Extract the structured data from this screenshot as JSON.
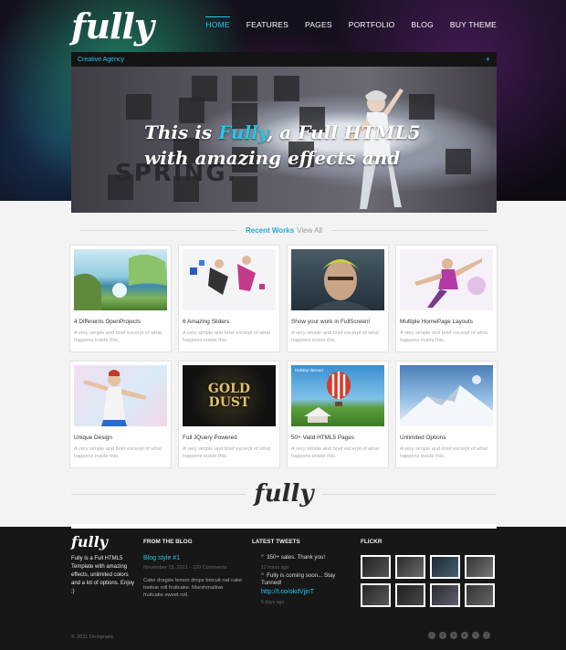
{
  "header": {
    "logo": "fully",
    "nav": [
      "HOME",
      "FEATURES",
      "PAGES",
      "PORTFOLIO",
      "BLOG",
      "BUY THEME"
    ]
  },
  "slider": {
    "caption": "Creative Agency",
    "plus": "+",
    "headline_part1": "This is ",
    "headline_accent": "Fully",
    "headline_part2": ", a Full HTML5",
    "headline_line2": "with amazing effects and",
    "overlay_word": "SPRING."
  },
  "recent_works": {
    "title": "Recent Works",
    "view_all": "View All",
    "items": [
      {
        "title": "4 Differents OpenProjects",
        "desc": "A very simple and brief excerpt of what happens inside this."
      },
      {
        "title": "6 Amazing Sliders",
        "desc": "A very simple and brief excerpt of what happens inside this."
      },
      {
        "title": "Show your work in FullScreen!",
        "desc": "A very simple and brief excerpt of what happens inside this."
      },
      {
        "title": "Multiple HomePage Layouts",
        "desc": "A very simple and brief excerpt of what happens inside this."
      },
      {
        "title": "Unique Design",
        "desc": "A very simple and brief excerpt of what happens inside this."
      },
      {
        "title": "Full JQuery Powered",
        "desc": "A very simple and brief excerpt of what happens inside this."
      },
      {
        "title": "50+ Valid HTML5 Pages",
        "desc": "A very simple and brief excerpt of what happens inside this."
      },
      {
        "title": "Unlimited Options",
        "desc": "A very simple and brief excerpt of what happens inside this."
      }
    ],
    "thumb_texts": {
      "gold_dust": "GOLD DUST",
      "holiday": "Holiday dessert"
    }
  },
  "divider_logo": "fully",
  "footer": {
    "logo": "fully",
    "about": "Fully is a Full HTML5 Template with amazing effects, unlimited colors and a lot of options. Enjoy ;)",
    "blog": {
      "title": "FROM THE BLOG",
      "post_title": "Blog style #1",
      "post_meta": "November 15, 2011 - 120 Comments",
      "post_excerpt": "Cake dragée lemon drops biscuit oat cake tootsie roll fruitcake. Marshmallow fruitcake sweet roll."
    },
    "tweets": {
      "title": "LATEST TWEETS",
      "items": [
        {
          "text": "350+ sales. Thank you!",
          "time": "12 hours ago"
        },
        {
          "text": "Fully is coming soon... Stay Tunned!",
          "link": "http://t.co/okdVjjnT",
          "time": "5 days ago"
        }
      ]
    },
    "flickr": {
      "title": "FLICKR"
    },
    "copyright": "© 2011 Designare",
    "social_icons": [
      "facebook-icon",
      "skype-icon",
      "vimeo-icon",
      "youtube-icon",
      "flickr-icon",
      "rss-icon"
    ]
  },
  "colors": {
    "accent": "#28c4ea",
    "footer_bg": "#171717",
    "page_bg": "#f3f3f3"
  }
}
